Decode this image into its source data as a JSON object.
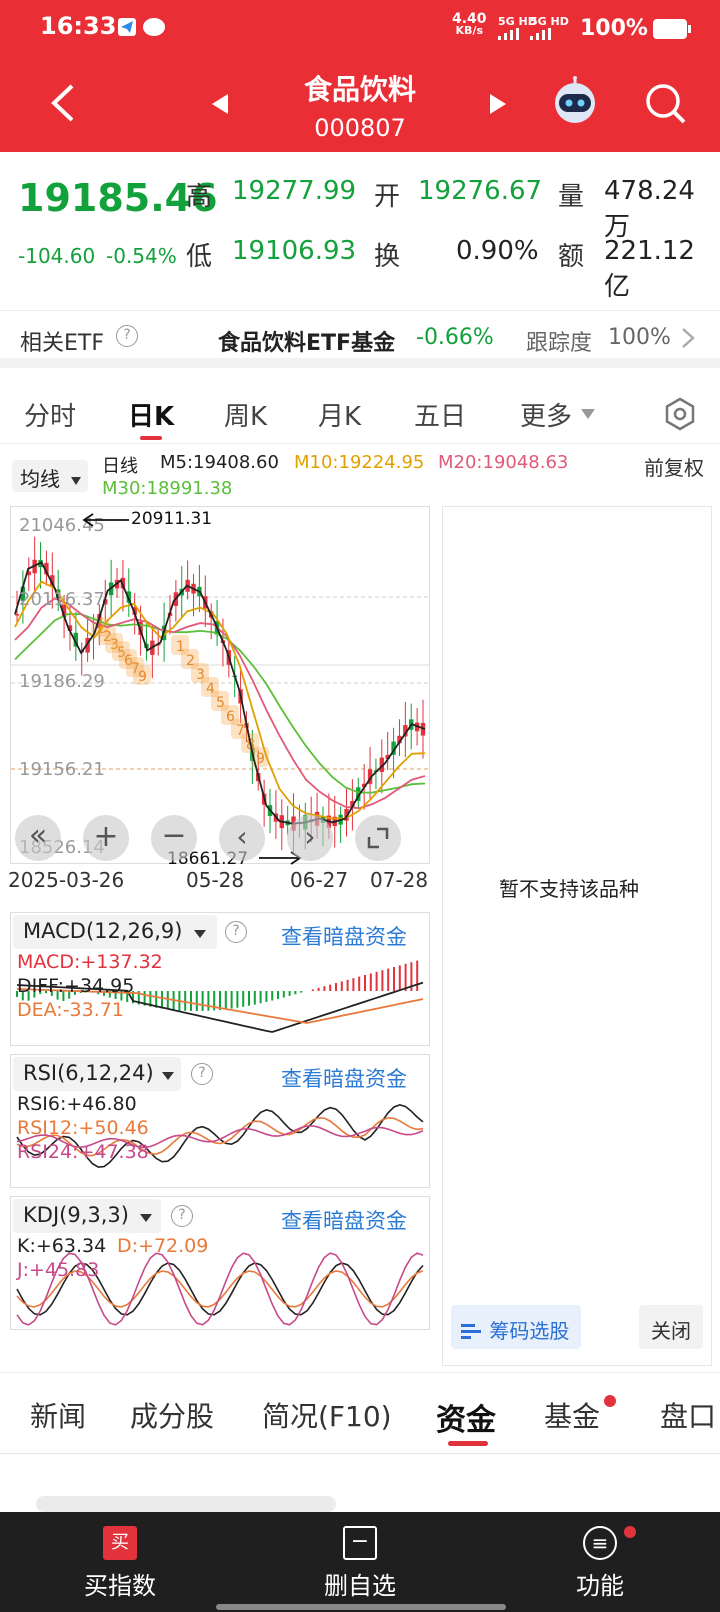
{
  "status": {
    "time": "16:33",
    "net_rate": "4.40",
    "net_unit": "KB/s",
    "sig1": "5G HD",
    "sig2": "5G HD",
    "battery": "100%"
  },
  "header": {
    "title": "食品饮料",
    "code": "000807"
  },
  "quote": {
    "price": "19185.46",
    "change": "-104.60",
    "change_pct": "-0.54%",
    "high_label": "高",
    "high": "19277.99",
    "open_label": "开",
    "open": "19276.67",
    "vol_label": "量",
    "vol": "478.24万",
    "low_label": "低",
    "low": "19106.93",
    "turn_label": "换",
    "turn": "0.90%",
    "amt_label": "额",
    "amt": "221.12亿"
  },
  "etf": {
    "label": "相关ETF",
    "help": "?",
    "name": "食品饮料ETF基金",
    "change": "-0.66%",
    "track_label": "跟踪度",
    "track": "100%"
  },
  "tabs": [
    "分时",
    "日K",
    "周K",
    "月K",
    "五日",
    "更多"
  ],
  "active_tab": "日K",
  "ma": {
    "selector": "均线",
    "period": "日线",
    "m5": "M5:19408.60",
    "m10": "M10:19224.95",
    "m20": "M20:19048.63",
    "m30": "M30:18991.38",
    "adjust": "前复权",
    "colors": {
      "m5": "#222222",
      "m10": "#e0a000",
      "m20": "#e05a7a",
      "m30": "#5bbf3a"
    }
  },
  "kchart": {
    "y_labels": [
      "21046.45",
      "20116.37",
      "19186.29",
      "19156.21",
      "18526.14"
    ],
    "high_mark": "20911.31",
    "low_mark": "18661.27",
    "x_labels": [
      "2025-03-26",
      "05-28",
      "06-27",
      "07-28"
    ],
    "demark_buy": [
      "1",
      "2",
      "3",
      "5",
      "6",
      "7",
      "9"
    ],
    "demark_sell": [
      "1",
      "2",
      "3",
      "4",
      "5",
      "6",
      "7",
      "8",
      "9"
    ],
    "ma_values": {
      "m5": [
        20300,
        20650,
        20700,
        20500,
        20200,
        20000,
        20150,
        20480,
        20560,
        20320,
        20020,
        20080,
        20400,
        20520,
        20470,
        20260,
        20020,
        19700,
        19200,
        18820,
        18700,
        18680,
        18690,
        18720,
        18690,
        18720,
        18900,
        19050,
        19150,
        19300,
        19450,
        19410
      ],
      "m10": [
        20200,
        20400,
        20550,
        20500,
        20350,
        20200,
        20120,
        20250,
        20350,
        20380,
        20230,
        20120,
        20200,
        20320,
        20350,
        20300,
        20150,
        19900,
        19550,
        19200,
        18950,
        18820,
        18760,
        18740,
        18720,
        18720,
        18780,
        18880,
        19000,
        19120,
        19220,
        19225
      ],
      "m20": [
        20100,
        20200,
        20350,
        20420,
        20380,
        20300,
        20230,
        20200,
        20230,
        20260,
        20240,
        20180,
        20160,
        20200,
        20230,
        20220,
        20130,
        19980,
        19780,
        19560,
        19360,
        19180,
        19020,
        18930,
        18860,
        18810,
        18800,
        18830,
        18880,
        18950,
        19020,
        19049
      ],
      "m30": [
        19950,
        20050,
        20150,
        20250,
        20300,
        20300,
        20260,
        20220,
        20210,
        20220,
        20210,
        20180,
        20160,
        20160,
        20170,
        20160,
        20110,
        20020,
        19900,
        19760,
        19590,
        19430,
        19280,
        19150,
        19040,
        18960,
        18920,
        18920,
        18940,
        18960,
        18985,
        18991
      ]
    },
    "not_supported": "暂不支持该品种",
    "chip_button": "筹码选股",
    "close_button": "关闭"
  },
  "macd": {
    "title": "MACD(12,26,9)",
    "link": "查看暗盘资金",
    "macd": "MACD:+137.32",
    "diff": "DIFF:+34.95",
    "dea": "DEA:-33.71"
  },
  "rsi": {
    "title": "RSI(6,12,24)",
    "link": "查看暗盘资金",
    "rsi6": "RSI6:+46.80",
    "rsi12": "RSI12:+50.46",
    "rsi24": "RSI24:+47.38"
  },
  "kdj": {
    "title": "KDJ(9,3,3)",
    "link": "查看暗盘资金",
    "k": "K:+63.34",
    "d": "D:+72.09",
    "j": "J:+45.83"
  },
  "bottom_tabs": [
    "新闻",
    "成分股",
    "简况(F10)",
    "资金",
    "基金",
    "盘口"
  ],
  "active_bottom_tab": "资金",
  "nav": [
    {
      "label": "买指数",
      "icon": "买"
    },
    {
      "label": "删自选",
      "icon": "−"
    },
    {
      "label": "功能",
      "icon": "≡"
    }
  ]
}
